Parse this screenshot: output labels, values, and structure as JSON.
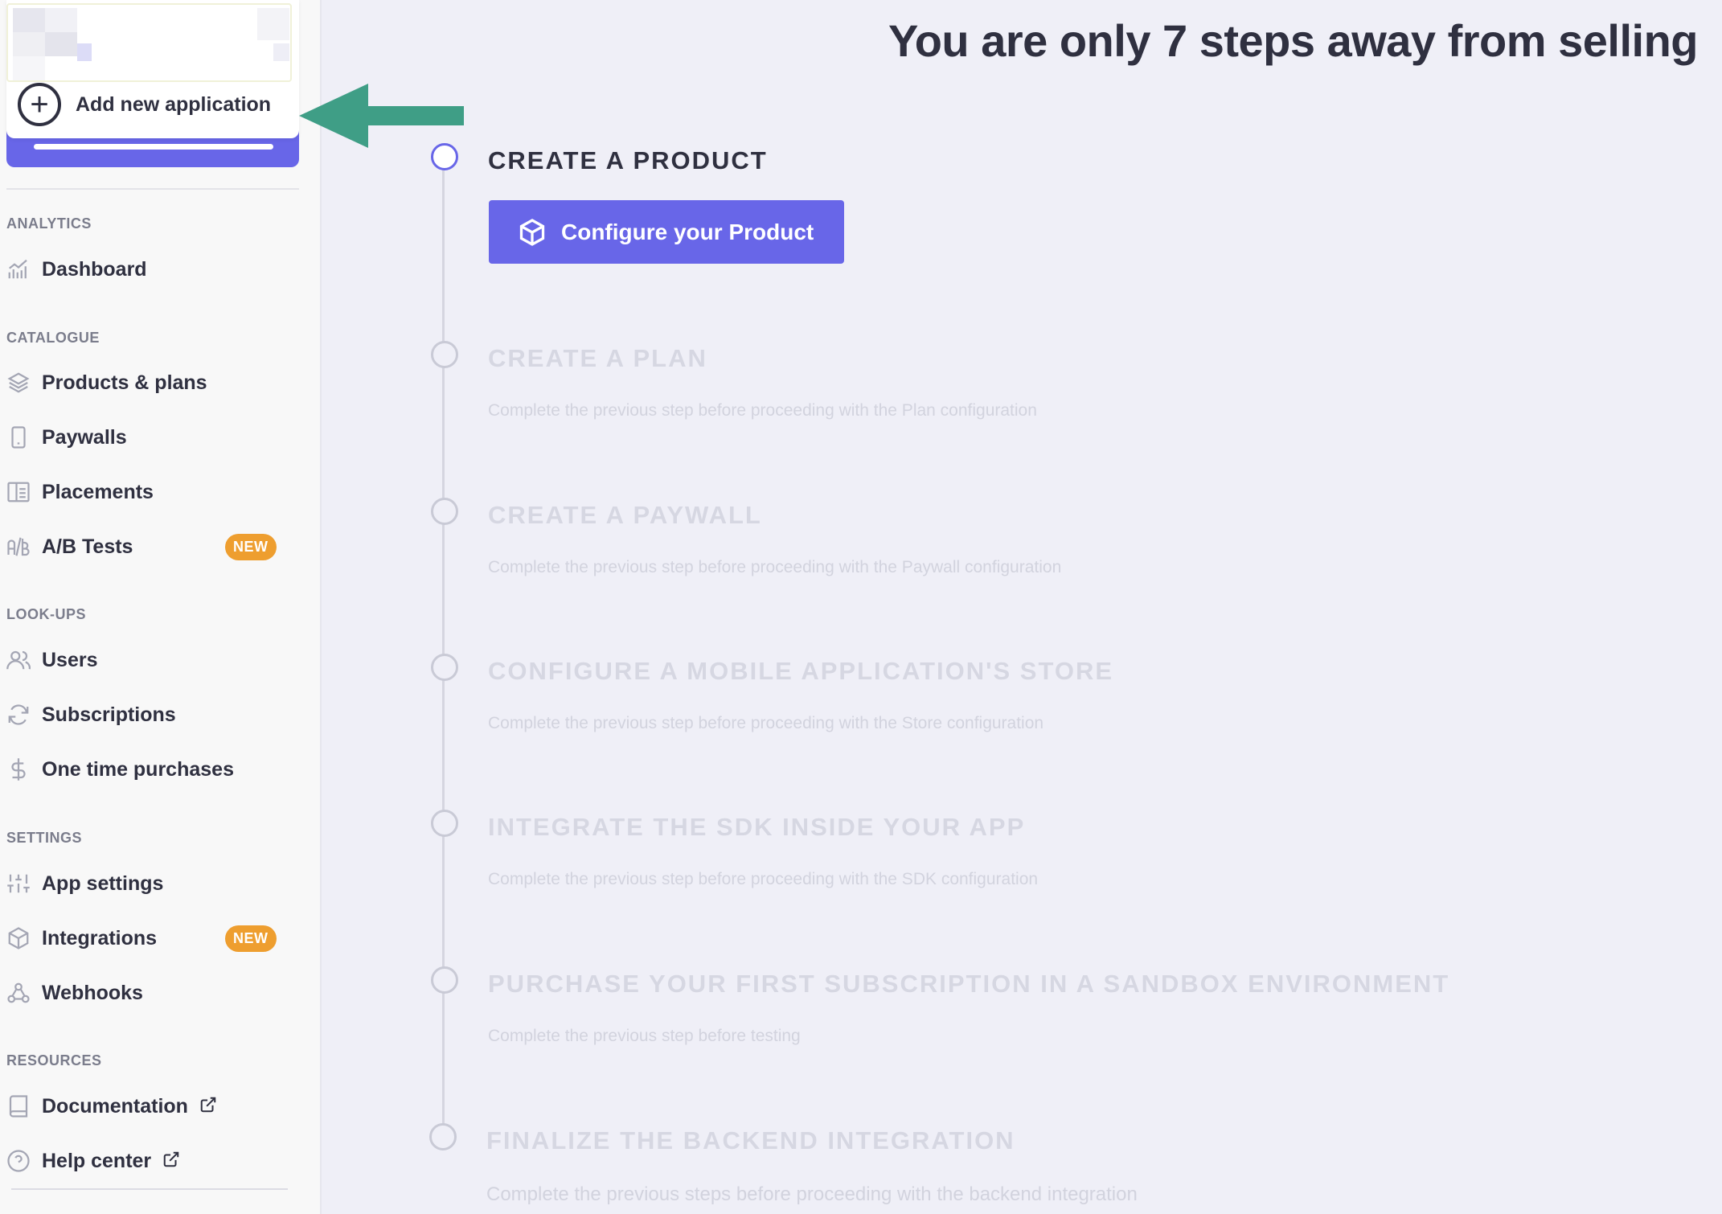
{
  "sidebar": {
    "add_app_label": "Add new application",
    "sections": [
      {
        "title": "ANALYTICS"
      },
      {
        "title": "CATALOGUE"
      },
      {
        "title": "LOOK-UPS"
      },
      {
        "title": "SETTINGS"
      },
      {
        "title": "RESOURCES"
      }
    ],
    "items": [
      {
        "label": "Dashboard",
        "icon": "chart-icon"
      },
      {
        "label": "Products & plans",
        "icon": "layers-icon"
      },
      {
        "label": "Paywalls",
        "icon": "phone-icon"
      },
      {
        "label": "Placements",
        "icon": "layout-icon"
      },
      {
        "label": "A/B Tests",
        "icon": "ab-icon",
        "badge": "NEW"
      },
      {
        "label": "Users",
        "icon": "users-icon"
      },
      {
        "label": "Subscriptions",
        "icon": "refresh-icon"
      },
      {
        "label": "One time purchases",
        "icon": "dollar-icon"
      },
      {
        "label": "App settings",
        "icon": "sliders-icon"
      },
      {
        "label": "Integrations",
        "icon": "cube-icon",
        "badge": "NEW"
      },
      {
        "label": "Webhooks",
        "icon": "webhook-icon"
      },
      {
        "label": "Documentation",
        "icon": "book-icon",
        "external": true
      },
      {
        "label": "Help center",
        "icon": "help-icon",
        "external": true
      }
    ]
  },
  "main": {
    "title": "You are only 7 steps away from selling",
    "cta_label": "Configure your Product",
    "steps": [
      {
        "title": "CREATE A PRODUCT",
        "desc": "",
        "active": true
      },
      {
        "title": "CREATE A PLAN",
        "desc": "Complete the previous step before proceeding with the Plan configuration"
      },
      {
        "title": "CREATE A PAYWALL",
        "desc": "Complete the previous step before proceeding with the Paywall configuration"
      },
      {
        "title": "CONFIGURE A MOBILE APPLICATION'S STORE",
        "desc": "Complete the previous step before proceeding with the Store configuration"
      },
      {
        "title": "INTEGRATE THE SDK INSIDE YOUR APP",
        "desc": "Complete the previous step before proceeding with the SDK configuration"
      },
      {
        "title": "PURCHASE YOUR FIRST SUBSCRIPTION IN A SANDBOX ENVIRONMENT",
        "desc": "Complete the previous step before testing"
      },
      {
        "title": "FINALIZE THE BACKEND INTEGRATION",
        "desc": "Complete the previous steps before proceeding with the backend integration"
      }
    ]
  },
  "colors": {
    "accent": "#6866e8",
    "badge": "#ee9e2f",
    "arrow": "#3f9e86"
  }
}
